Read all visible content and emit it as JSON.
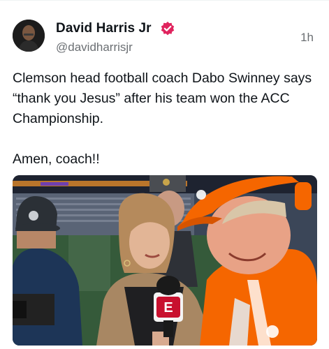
{
  "author": {
    "display_name": "David Harris Jr",
    "handle": "@davidharrisjr",
    "verified_icon": "verified-badge-icon",
    "verified_color": "#e0245e"
  },
  "post": {
    "time_ago": "1h",
    "text": "Clemson head football coach Dabo Swinney says “thank you Jesus” after his team won the ACC Championship.\n\nAmen, coach!!"
  },
  "media": {
    "mic_flag_label": "E"
  },
  "colors": {
    "clemson_orange": "#f56600",
    "text_secondary": "#6b6f73"
  }
}
